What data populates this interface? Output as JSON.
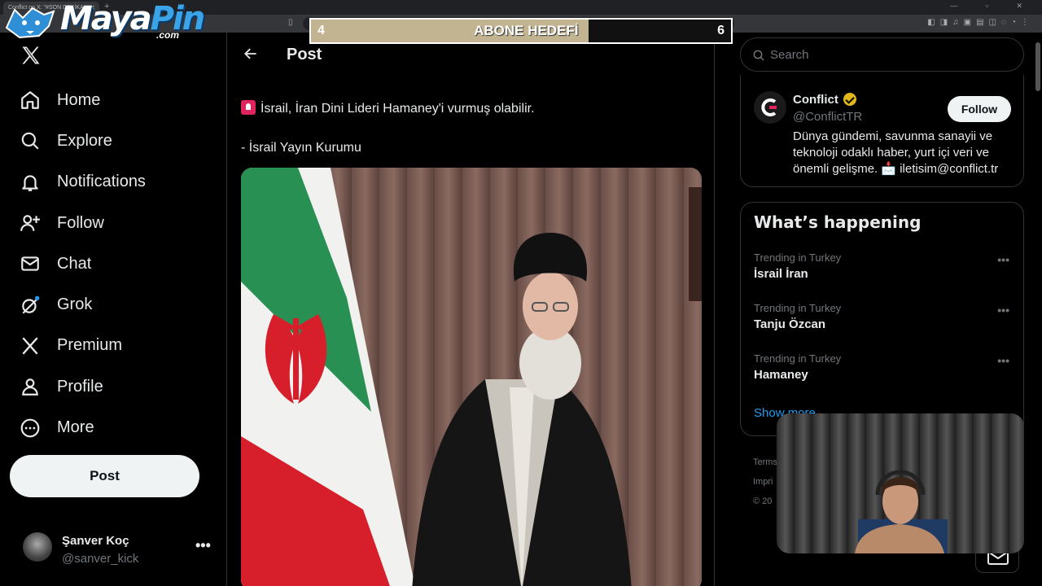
{
  "browser": {
    "tab_title": "Conflict on X: \"#SON DAKİKA",
    "tab_close": "✕",
    "new_tab": "+",
    "window_controls": "— ▫ ✕"
  },
  "overlay": {
    "brand_maya": "Maya",
    "brand_pin": "Pin",
    "brand_com": ".com",
    "goal_label": "ABONE HEDEFİ",
    "goal_current": "4",
    "goal_target": "6",
    "goal_progress_percent": 66
  },
  "sidebar": {
    "items": [
      {
        "label": "Home",
        "icon": "home-icon"
      },
      {
        "label": "Explore",
        "icon": "search-icon"
      },
      {
        "label": "Notifications",
        "icon": "bell-icon"
      },
      {
        "label": "Follow",
        "icon": "person-add-icon"
      },
      {
        "label": "Chat",
        "icon": "mail-icon"
      },
      {
        "label": "Grok",
        "icon": "grok-icon"
      },
      {
        "label": "Premium",
        "icon": "x-logo-icon"
      },
      {
        "label": "Profile",
        "icon": "person-icon"
      },
      {
        "label": "More",
        "icon": "more-circle-icon"
      }
    ],
    "post_button": "Post",
    "account": {
      "name": "Şanver Koç",
      "handle": "@sanver_kick",
      "more": "•••"
    }
  },
  "main": {
    "header_title": "Post",
    "post_line1": "İsrail, İran Dini Lideri Hamaney'i vurmuş olabilir.",
    "post_line2": "- İsrail Yayın Kurumu"
  },
  "right": {
    "search_placeholder": "Search",
    "profile_card": {
      "name": "Conflict",
      "handle": "@ConflictTR",
      "bio": "Dünya gündemi, savunma sanayii ve teknoloji odaklı haber, yurt içi veri ve önemli gelişme. 📩 iletisim@conflict.tr",
      "follow_label": "Follow"
    },
    "whats_happening": {
      "title": "What’s happening",
      "trends": [
        {
          "context": "Trending in Turkey",
          "name": "İsrail İran"
        },
        {
          "context": "Trending in Turkey",
          "name": "Tanju Özcan"
        },
        {
          "context": "Trending in Turkey",
          "name": "Hamaney"
        }
      ],
      "show_more": "Show more"
    },
    "footer": {
      "line1": "Terms",
      "line2": "Impri",
      "line3": "© 20"
    }
  },
  "colors": {
    "background": "#000000",
    "accent": "#1d9bf0",
    "text": "#e7e9ea",
    "muted": "#71767b",
    "goal_fill": "#c2b491"
  }
}
